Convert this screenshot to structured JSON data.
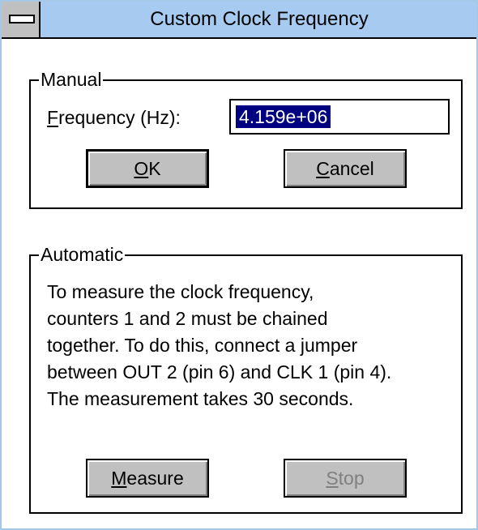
{
  "window": {
    "title": "Custom Clock Frequency"
  },
  "manual": {
    "group_label": "Manual",
    "frequency_label_accel": "F",
    "frequency_label_rest": "requency (Hz):",
    "frequency_value": "4.159e+06",
    "ok_accel": "O",
    "ok_rest": "K",
    "cancel_accel": "C",
    "cancel_rest": "ancel"
  },
  "automatic": {
    "group_label": "Automatic",
    "description_lines": [
      "To measure the clock frequency,",
      "counters 1 and 2 must be chained",
      "together.  To do this, connect a jumper",
      "between OUT 2 (pin 6) and CLK 1 (pin 4).",
      "The measurement takes 30 seconds."
    ],
    "measure_accel": "M",
    "measure_rest": "easure",
    "stop_accel": "S",
    "stop_rest": "top"
  },
  "colors": {
    "titlebar": "#a6caf0",
    "button_face": "#c0c0c0",
    "selection": "#000080",
    "disabled_text": "#808080"
  },
  "icons": {
    "system_menu": "system-menu-icon"
  }
}
